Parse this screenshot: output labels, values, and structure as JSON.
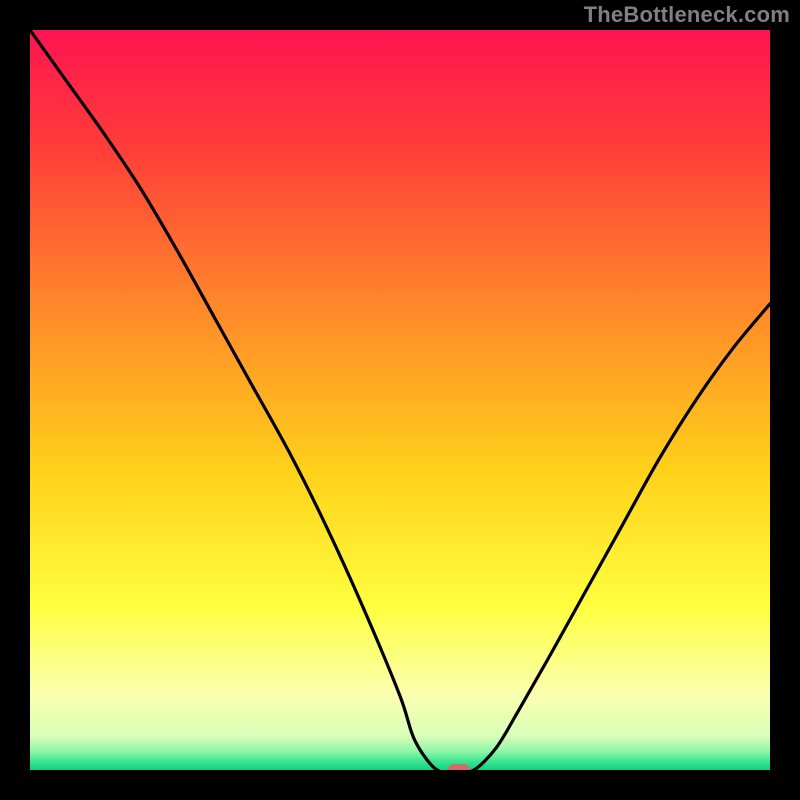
{
  "watermark": "TheBottleneck.com",
  "colors": {
    "frame": "#000000",
    "curve": "#000000",
    "marker": "#d46a6a",
    "gradient_stops": [
      {
        "offset": 0,
        "color": "#ff1452"
      },
      {
        "offset": 0.15,
        "color": "#ff3a3a"
      },
      {
        "offset": 0.38,
        "color": "#ff8a2a"
      },
      {
        "offset": 0.6,
        "color": "#ffd21a"
      },
      {
        "offset": 0.78,
        "color": "#ffff40"
      },
      {
        "offset": 0.9,
        "color": "#faffb0"
      },
      {
        "offset": 0.955,
        "color": "#d8ffb8"
      },
      {
        "offset": 0.975,
        "color": "#8cf5a8"
      },
      {
        "offset": 0.99,
        "color": "#33e38f"
      },
      {
        "offset": 1.0,
        "color": "#13cf82"
      }
    ]
  },
  "chart_data": {
    "type": "line",
    "title": "",
    "xlabel": "",
    "ylabel": "",
    "xlim": [
      0,
      100
    ],
    "ylim": [
      0,
      100
    ],
    "series": [
      {
        "name": "bottleneck-curve",
        "x": [
          0,
          5,
          10,
          15,
          20,
          25,
          30,
          35,
          40,
          45,
          50,
          52,
          55,
          58,
          60,
          63,
          66,
          70,
          75,
          80,
          85,
          90,
          95,
          100
        ],
        "y": [
          100,
          93,
          86,
          78.5,
          70,
          61,
          52,
          43,
          33,
          22,
          10,
          4,
          0,
          0,
          0,
          3,
          8,
          15,
          24,
          33,
          42,
          50,
          57,
          63
        ]
      }
    ],
    "marker": {
      "x": 58,
      "y": 0,
      "name": "optimal-point"
    }
  }
}
